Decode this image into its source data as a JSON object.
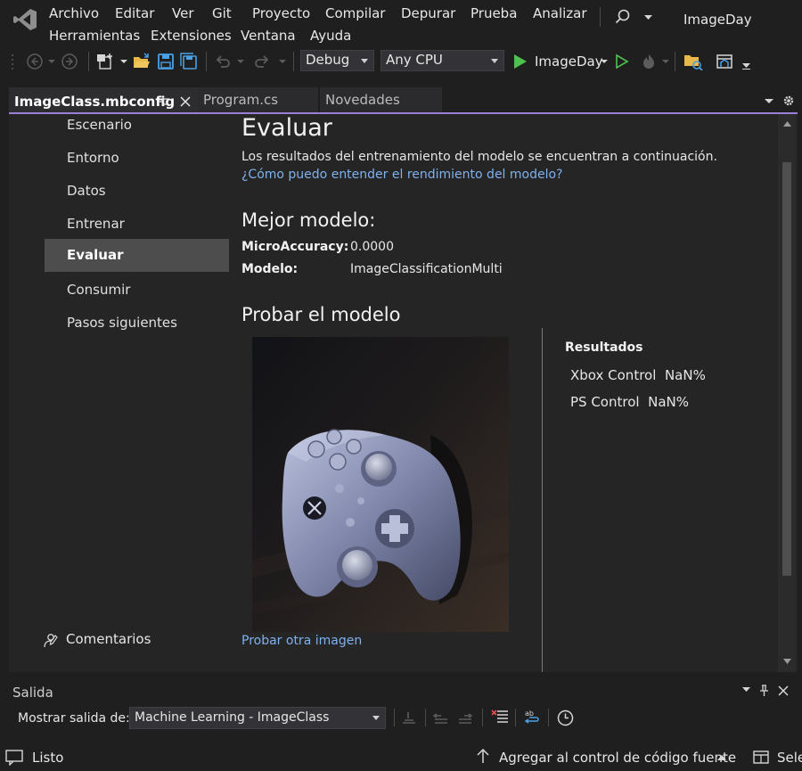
{
  "app": {
    "solution_name": "ImageDay"
  },
  "menu": {
    "items": [
      "Archivo",
      "Editar",
      "Ver",
      "Git",
      "Proyecto",
      "Compilar",
      "Depurar",
      "Prueba",
      "Analizar",
      "Herramientas",
      "Extensiones",
      "Ventana",
      "Ayuda"
    ]
  },
  "toolbar": {
    "configuration": "Debug",
    "platform": "Any CPU",
    "start_target": "ImageDay"
  },
  "tabs": [
    {
      "label": "ImageClass.mbconfig",
      "active": true
    },
    {
      "label": "Program.cs",
      "active": false
    },
    {
      "label": "Novedades",
      "active": false
    }
  ],
  "nav": {
    "items": [
      {
        "label": "Escenario",
        "selected": false
      },
      {
        "label": "Entorno",
        "selected": false
      },
      {
        "label": "Datos",
        "selected": false
      },
      {
        "label": "Entrenar",
        "selected": false
      },
      {
        "label": "Evaluar",
        "selected": true
      },
      {
        "label": "Consumir",
        "selected": false
      },
      {
        "label": "Pasos siguientes",
        "selected": false
      }
    ],
    "feedback_label": "Comentarios"
  },
  "evaluate": {
    "title": "Evaluar",
    "description": "Los resultados del entrenamiento del modelo se encuentran a continuación.",
    "help_link": "¿Cómo puedo entender el rendimiento del modelo?",
    "best_model_title": "Mejor modelo:",
    "metric_label": "MicroAccuracy:",
    "metric_value": "0.0000",
    "model_label": "Modelo:",
    "model_value": "ImageClassificationMulti",
    "test_title": "Probar el modelo",
    "try_another_link": "Probar otra imagen",
    "results_title": "Resultados",
    "results": [
      {
        "label": "Xbox Control",
        "value": "NaN%"
      },
      {
        "label": "PS Control",
        "value": "NaN%"
      }
    ]
  },
  "output": {
    "title": "Salida",
    "show_output_label": "Mostrar salida de:",
    "source": "Machine Learning - ImageClass"
  },
  "status": {
    "ready": "Listo",
    "source_control": "Agregar al control de código fuente",
    "select_repo": "Sele"
  },
  "colors": {
    "accent": "#9a7fd6",
    "link": "#7fb1ec",
    "run_green": "#4ec24e",
    "selected_nav": "#4d4d4d"
  }
}
